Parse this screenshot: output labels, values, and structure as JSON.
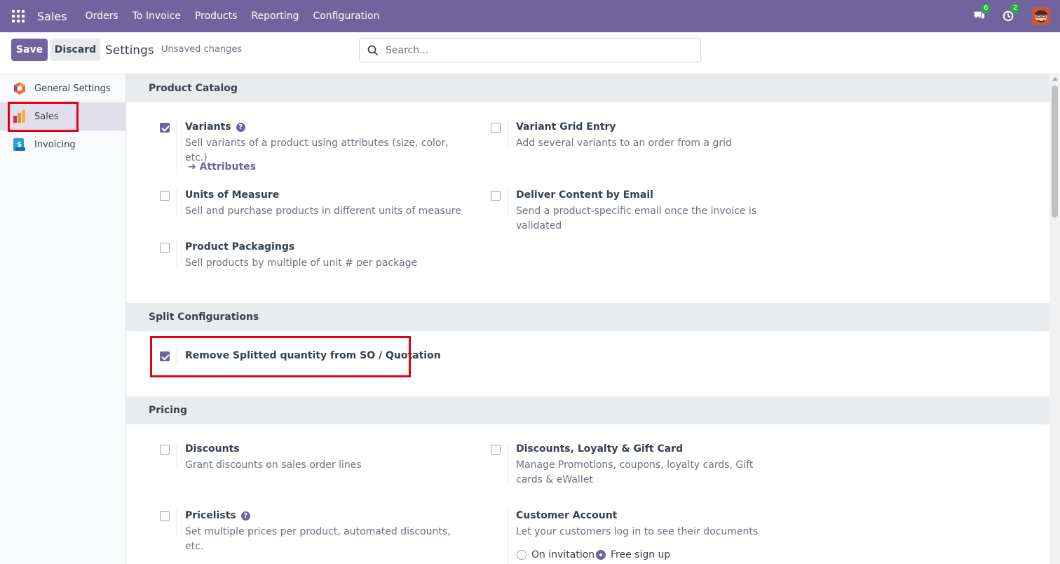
{
  "navbar": {
    "brand": "Sales",
    "menu": [
      "Orders",
      "To Invoice",
      "Products",
      "Reporting",
      "Configuration"
    ],
    "messages_count": "6",
    "activities_count": "2"
  },
  "control": {
    "save_label": "Save",
    "discard_label": "Discard",
    "title": "Settings",
    "unsaved": "Unsaved changes",
    "search_placeholder": "Search..."
  },
  "sidebar": {
    "items": [
      {
        "label": "General Settings",
        "icon": "odoo-logo-icon",
        "active": false
      },
      {
        "label": "Sales",
        "icon": "sales-app-icon",
        "active": true
      },
      {
        "label": "Invoicing",
        "icon": "invoicing-app-icon",
        "active": false
      }
    ]
  },
  "sections": {
    "product_catalog": {
      "title": "Product Catalog",
      "variants": {
        "title": "Variants",
        "desc": "Sell variants of a product using attributes (size, color, etc.)",
        "checked": true,
        "link": "Attributes"
      },
      "variant_grid": {
        "title": "Variant Grid Entry",
        "desc": "Add several variants to an order from a grid",
        "checked": false
      },
      "uom": {
        "title": "Units of Measure",
        "desc": "Sell and purchase products in different units of measure",
        "checked": false
      },
      "deliver_email": {
        "title": "Deliver Content by Email",
        "desc": "Send a product-specific email once the invoice is validated",
        "checked": false
      },
      "packagings": {
        "title": "Product Packagings",
        "desc": "Sell products by multiple of unit # per package",
        "checked": false
      }
    },
    "split": {
      "title": "Split Configurations",
      "remove_split": {
        "title": "Remove Splitted quantity from SO / Quotation",
        "checked": true
      }
    },
    "pricing": {
      "title": "Pricing",
      "discounts": {
        "title": "Discounts",
        "desc": "Grant discounts on sales order lines",
        "checked": false
      },
      "loyalty": {
        "title": "Discounts, Loyalty & Gift Card",
        "desc": "Manage Promotions, coupons, loyalty cards, Gift cards & eWallet",
        "checked": false
      },
      "pricelists": {
        "title": "Pricelists",
        "desc": "Set multiple prices per product, automated discounts, etc.",
        "checked": false
      },
      "customer_account": {
        "title": "Customer Account",
        "desc": "Let your customers log in to see their documents",
        "options": [
          "On invitation",
          "Free sign up"
        ],
        "selected": "Free sign up"
      }
    }
  },
  "colors": {
    "brand": "#71639e",
    "highlight": "#e3000f",
    "badge": "#28a745"
  }
}
